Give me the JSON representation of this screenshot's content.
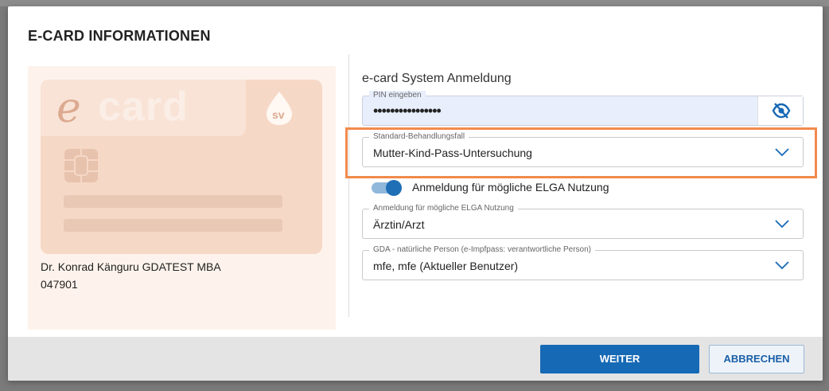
{
  "dialog": {
    "title": "E-CARD INFORMATIONEN"
  },
  "card": {
    "logo_e": "e",
    "logo_text": "card",
    "sv_logo": "sv",
    "holder_name": "Dr. Konrad Känguru GDATEST MBA",
    "holder_id": "047901",
    "colors": {
      "card": "#f6d8c6",
      "panel": "#fdf3ec"
    }
  },
  "form": {
    "section_title": "e-card System Anmeldung",
    "pin": {
      "label": "PIN eingeben",
      "value": "••••••••••••••••",
      "toggle_icon": "eye-off-icon"
    },
    "standard_case": {
      "label": "Standard-Behandlungsfall",
      "value": "Mutter-Kind-Pass-Untersuchung"
    },
    "elga_toggle": {
      "label": "Anmeldung für mögliche ELGA Nutzung",
      "on": true
    },
    "elga_role": {
      "label": "Anmeldung für mögliche ELGA Nutzung",
      "value": "Ärztin/Arzt"
    },
    "gda": {
      "label": "GDA - natürliche Person (e-Impfpass: verantwortliche Person)",
      "value": "mfe, mfe (Aktueller Benutzer)"
    }
  },
  "footer": {
    "primary_label": "WEITER",
    "secondary_label": "ABBRECHEN"
  },
  "colors": {
    "accent": "#1669b5",
    "highlight": "#f28a4c"
  }
}
